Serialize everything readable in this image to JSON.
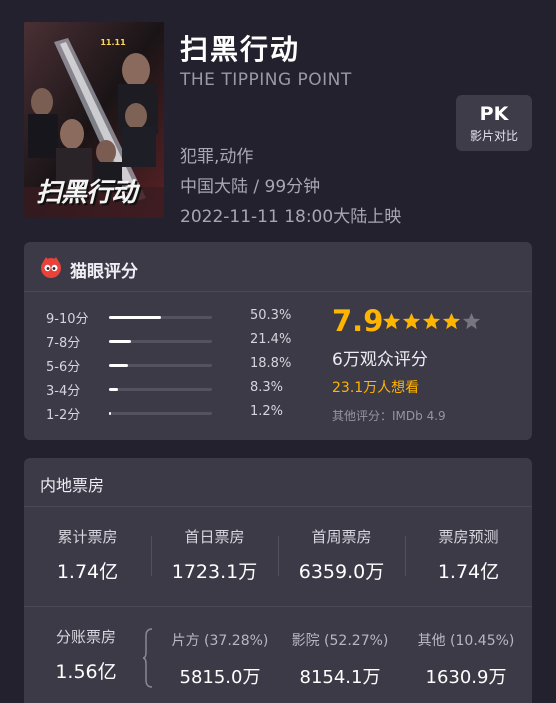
{
  "movie": {
    "title": "扫黑行动",
    "english_title": "THE TIPPING POINT",
    "genres": "犯罪,动作",
    "region_duration": "中国大陆 / 99分钟",
    "release": "2022-11-11 18:00大陆上映",
    "poster_title": "扫黑行动",
    "poster_date": "11.11"
  },
  "pk": {
    "main": "PK",
    "sub": "影片对比"
  },
  "rating": {
    "section_title": "猫眼评分",
    "score": "7.9",
    "stars_filled": 4,
    "stars_total": 5,
    "audience_count": "6万观众评分",
    "want_to_see": "23.1万人想看",
    "other_rating": "其他评分：IMDb 4.9",
    "distribution": [
      {
        "label": "9-10分",
        "percent": "50.3%",
        "value": 0.503
      },
      {
        "label": "7-8分",
        "percent": "21.4%",
        "value": 0.214
      },
      {
        "label": "5-6分",
        "percent": "18.8%",
        "value": 0.188
      },
      {
        "label": "3-4分",
        "percent": "8.3%",
        "value": 0.083
      },
      {
        "label": "1-2分",
        "percent": "1.2%",
        "value": 0.012
      }
    ]
  },
  "box_office": {
    "section_title": "内地票房",
    "stats": [
      {
        "label": "累计票房",
        "value": "1.74亿"
      },
      {
        "label": "首日票房",
        "value": "1723.1万"
      },
      {
        "label": "首周票房",
        "value": "6359.0万"
      },
      {
        "label": "票房预测",
        "value": "1.74亿"
      }
    ],
    "split": {
      "label": "分账票房",
      "value": "1.56亿",
      "items": [
        {
          "label": "片方 (37.28%)",
          "value": "5815.0万"
        },
        {
          "label": "影院 (52.27%)",
          "value": "8154.1万"
        },
        {
          "label": "其他 (10.45%)",
          "value": "1630.9万"
        }
      ]
    }
  },
  "colors": {
    "background": "#23212d",
    "card": "#3c3a46",
    "accent_gold": "#ffb400",
    "cat_red": "#e8423a"
  }
}
